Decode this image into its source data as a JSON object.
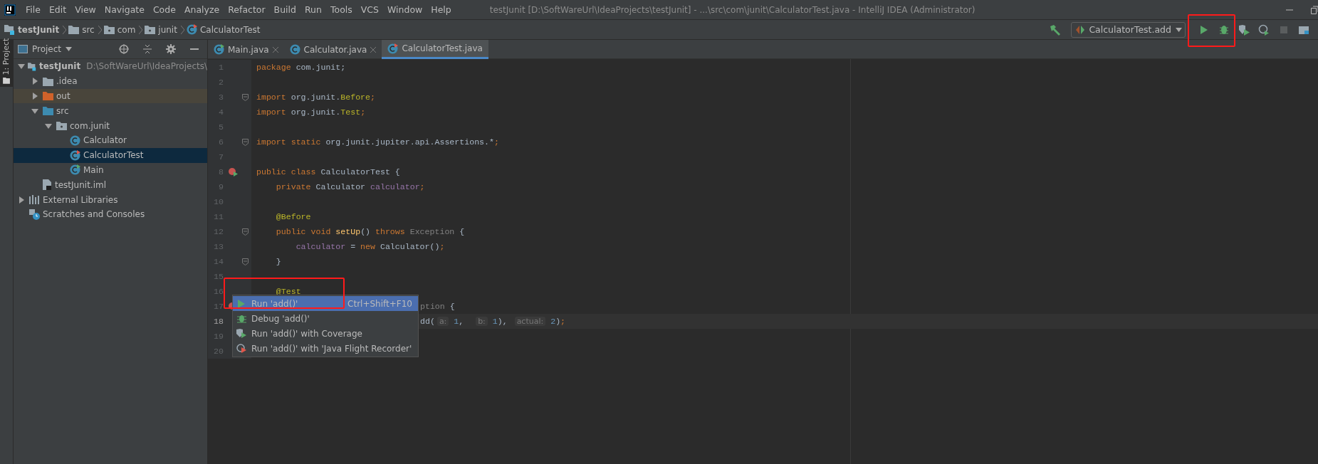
{
  "window": {
    "title": "testJunit [D:\\SoftWareUrl\\IdeaProjects\\testJunit] - ...\\src\\com\\junit\\CalculatorTest.java - IntelliJ IDEA (Administrator)"
  },
  "menu": [
    "File",
    "Edit",
    "View",
    "Navigate",
    "Code",
    "Analyze",
    "Refactor",
    "Build",
    "Run",
    "Tools",
    "VCS",
    "Window",
    "Help"
  ],
  "breadcrumbs": [
    {
      "kind": "module",
      "label": "testJunit"
    },
    {
      "kind": "folder",
      "label": "src"
    },
    {
      "kind": "package",
      "label": "com"
    },
    {
      "kind": "package",
      "label": "junit"
    },
    {
      "kind": "test-class",
      "label": "CalculatorTest"
    }
  ],
  "run_config": {
    "label": "CalculatorTest.add"
  },
  "side_stripe": {
    "label": "1: Project"
  },
  "project_panel": {
    "title": "Project",
    "tree": [
      {
        "kind": "module",
        "label": "testJunit",
        "path": "D:\\SoftWareUrl\\IdeaProjects\\",
        "expanded": true,
        "selected": false,
        "children": [
          {
            "kind": "folder",
            "label": ".idea",
            "expanded": false,
            "selected": false
          },
          {
            "kind": "excluded-folder",
            "label": "out",
            "expanded": false,
            "selected": false
          },
          {
            "kind": "source-folder",
            "label": "src",
            "expanded": true,
            "selected": false,
            "children": [
              {
                "kind": "package",
                "label": "com.junit",
                "expanded": true,
                "selected": false,
                "children": [
                  {
                    "kind": "class",
                    "label": "Calculator",
                    "selected": false
                  },
                  {
                    "kind": "test-class",
                    "label": "CalculatorTest",
                    "selected": true
                  },
                  {
                    "kind": "main-class",
                    "label": "Main",
                    "selected": false
                  }
                ]
              }
            ]
          },
          {
            "kind": "iml-file",
            "label": "testJunit.iml",
            "selected": false
          }
        ]
      },
      {
        "kind": "libraries",
        "label": "External Libraries",
        "expanded": false,
        "selected": false
      },
      {
        "kind": "scratches",
        "label": "Scratches and Consoles",
        "selected": false
      }
    ]
  },
  "tabs": [
    {
      "label": "Main.java",
      "kind": "main-class",
      "selected": false
    },
    {
      "label": "Calculator.java",
      "kind": "class",
      "selected": false
    },
    {
      "label": "CalculatorTest.java",
      "kind": "test-class",
      "selected": true
    }
  ],
  "code_lines": [
    {
      "number": "1",
      "current": false,
      "tokens": [
        {
          "kind": "keyword",
          "text": "package"
        },
        {
          "kind": "plain",
          "text": " com.junit;"
        }
      ]
    },
    {
      "number": "2",
      "current": false
    },
    {
      "number": "3",
      "current": false,
      "fold": true,
      "tokens": [
        {
          "kind": "keyword",
          "text": "import"
        },
        {
          "kind": "plain",
          "text": " org.junit."
        },
        {
          "kind": "annotation",
          "text": "Before"
        },
        {
          "kind": "keyword",
          "text": ";"
        }
      ]
    },
    {
      "number": "4",
      "current": false,
      "tokens": [
        {
          "kind": "keyword",
          "text": "import"
        },
        {
          "kind": "plain",
          "text": " org.junit."
        },
        {
          "kind": "annotation",
          "text": "Test"
        },
        {
          "kind": "keyword",
          "text": ";"
        }
      ]
    },
    {
      "number": "5",
      "current": false
    },
    {
      "number": "6",
      "current": false,
      "fold": true,
      "tokens": [
        {
          "kind": "keyword",
          "text": "import static"
        },
        {
          "kind": "plain",
          "text": " org.junit.jupiter.api.Assertions.*"
        },
        {
          "kind": "keyword",
          "text": ";"
        }
      ]
    },
    {
      "number": "7",
      "current": false
    },
    {
      "number": "8",
      "current": false,
      "run_marker": true,
      "tokens": [
        {
          "kind": "keyword",
          "text": "public class"
        },
        {
          "kind": "plain",
          "text": " CalculatorTest {"
        }
      ]
    },
    {
      "number": "9",
      "current": false,
      "tokens": [
        {
          "kind": "keyword",
          "text": "    private"
        },
        {
          "kind": "plain",
          "text": " Calculator "
        },
        {
          "kind": "field",
          "text": "calculator"
        },
        {
          "kind": "keyword",
          "text": ";"
        }
      ]
    },
    {
      "number": "10",
      "current": false
    },
    {
      "number": "11",
      "current": false,
      "tokens": [
        {
          "kind": "annotation",
          "text": "    @Before"
        }
      ]
    },
    {
      "number": "12",
      "current": false,
      "fold": true,
      "tokens": [
        {
          "kind": "keyword",
          "text": "    public void"
        },
        {
          "kind": "method",
          "text": " setUp"
        },
        {
          "kind": "plain",
          "text": "() "
        },
        {
          "kind": "keyword",
          "text": "throws"
        },
        {
          "kind": "type",
          "text": " Exception"
        },
        {
          "kind": "plain",
          "text": " {"
        }
      ]
    },
    {
      "number": "13",
      "current": false,
      "tokens": [
        {
          "kind": "field",
          "text": "        calculator"
        },
        {
          "kind": "plain",
          "text": " = "
        },
        {
          "kind": "keyword",
          "text": "new"
        },
        {
          "kind": "plain",
          "text": " Calculator()"
        },
        {
          "kind": "keyword",
          "text": ";"
        }
      ]
    },
    {
      "number": "14",
      "current": false,
      "fold": true,
      "tokens": [
        {
          "kind": "plain",
          "text": "    }"
        }
      ]
    },
    {
      "number": "15",
      "current": false
    },
    {
      "number": "16",
      "current": false,
      "tokens": [
        {
          "kind": "annotation",
          "text": "    @Test"
        }
      ]
    },
    {
      "number": "17",
      "current": false,
      "run_marker": true,
      "covered": true,
      "tokens": [
        {
          "kind": "type",
          "text": "ption"
        },
        {
          "kind": "plain",
          "text": " {"
        }
      ]
    },
    {
      "number": "18",
      "current": true,
      "covered": true,
      "tokens": [
        {
          "kind": "plain",
          "text": "dd("
        },
        {
          "kind": "hint",
          "text": "a:"
        },
        {
          "kind": "number",
          "text": " 1"
        },
        {
          "kind": "plain",
          "text": ",  "
        },
        {
          "kind": "hint",
          "text": "b:"
        },
        {
          "kind": "number",
          "text": " 1"
        },
        {
          "kind": "plain",
          "text": "), "
        },
        {
          "kind": "hint",
          "text": "actual:"
        },
        {
          "kind": "number",
          "text": " 2"
        },
        {
          "kind": "plain",
          "text": ")"
        },
        {
          "kind": "keyword",
          "text": ";"
        }
      ]
    },
    {
      "number": "19",
      "current": false
    },
    {
      "number": "20",
      "current": false
    }
  ],
  "popup_menu": [
    {
      "kind": "run",
      "label": "Run 'add()'",
      "shortcut": "Ctrl+Shift+F10",
      "selected": true
    },
    {
      "kind": "debug",
      "label": "Debug 'add()'",
      "selected": false
    },
    {
      "kind": "coverage",
      "label": "Run 'add()' with Coverage",
      "selected": false
    },
    {
      "kind": "profiler",
      "label": "Run 'add()' with 'Java Flight Recorder'",
      "selected": false
    }
  ]
}
